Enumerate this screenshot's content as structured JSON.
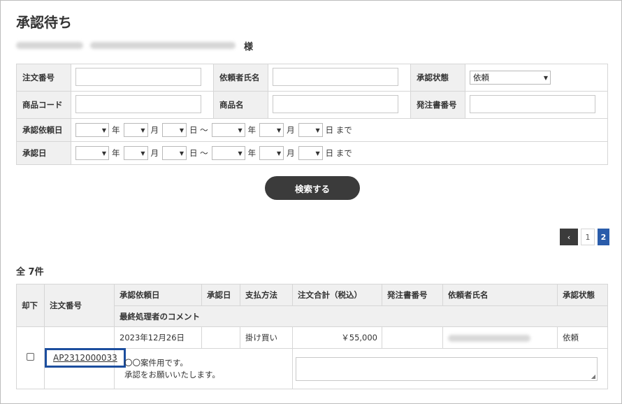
{
  "page": {
    "title": "承認待ち",
    "customer_suffix": "様"
  },
  "search": {
    "order_no_label": "注文番号",
    "requester_label": "依頼者氏名",
    "status_label": "承認状態",
    "status_value": "依頼",
    "product_code_label": "商品コード",
    "product_name_label": "商品名",
    "po_no_label": "発注書番号",
    "request_date_label": "承認依頼日",
    "approval_date_label": "承認日",
    "unit_year": "年",
    "unit_month": "月",
    "unit_day_from": "日 〜",
    "unit_day_to": "日 まで",
    "button_label": "検索する"
  },
  "pager": {
    "prev_label": "‹",
    "pages": [
      "1",
      "2"
    ],
    "current": "2"
  },
  "results": {
    "count_label": "全 7件",
    "headers": {
      "reject": "却下",
      "order_no": "注文番号",
      "request_date": "承認依頼日",
      "approval_date": "承認日",
      "payment": "支払方法",
      "total": "注文合計（税込）",
      "po_no": "発注書番号",
      "requester": "依頼者氏名",
      "status": "承認状態",
      "last_comment": "最終処理者のコメント"
    },
    "rows": [
      {
        "request_date": "2023年12月26日",
        "approval_date": "",
        "payment": "掛け買い",
        "total": "￥55,000",
        "po_no": "",
        "status": "依頼",
        "order_no": "AP2312000033",
        "comment_line1": "〇〇案件用です。",
        "comment_line2": "承認をお願いいたします。"
      }
    ]
  },
  "icons": {
    "select_arrow": "chevron-down-icon",
    "prev": "chevron-left-icon",
    "resize": "resize-grip-icon"
  },
  "colors": {
    "accent": "#2a5caa",
    "dark_button": "#3b3b3b",
    "highlight_border": "#1c4e9e",
    "label_bg": "#f0f0f0"
  }
}
